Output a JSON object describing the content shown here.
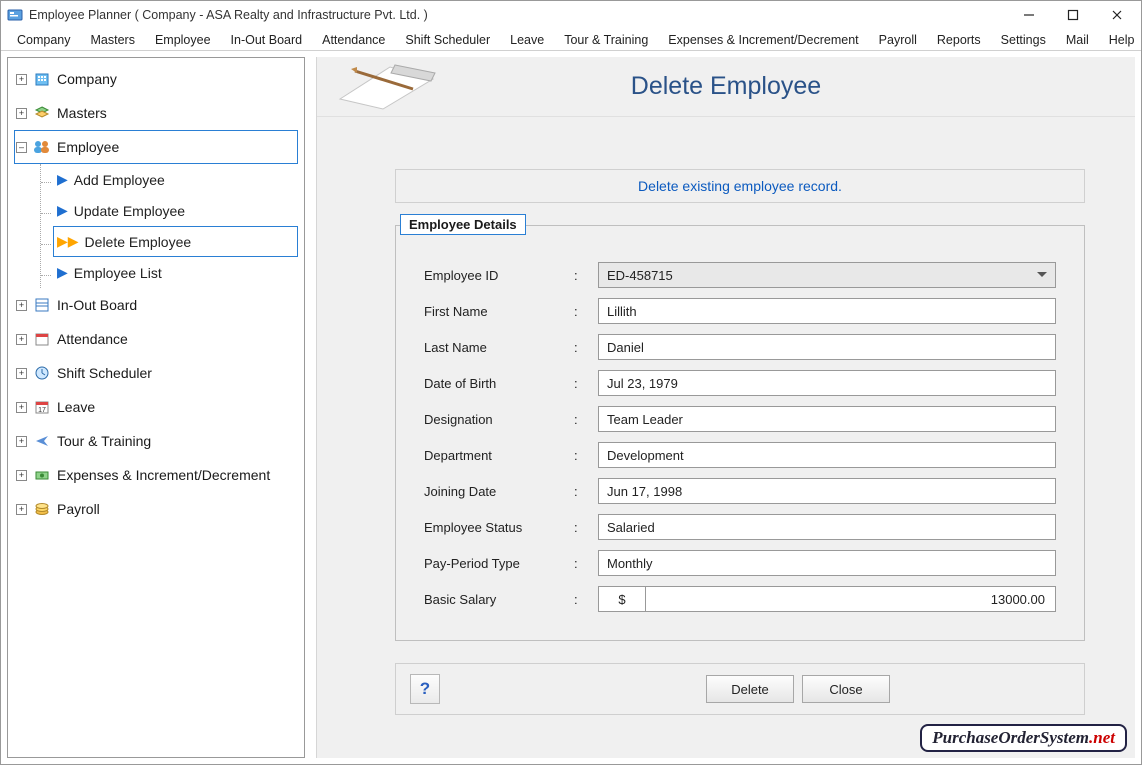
{
  "window": {
    "title": "Employee Planner ( Company - ASA Realty and Infrastructure Pvt. Ltd. )"
  },
  "menubar": [
    "Company",
    "Masters",
    "Employee",
    "In-Out Board",
    "Attendance",
    "Shift Scheduler",
    "Leave",
    "Tour & Training",
    "Expenses & Increment/Decrement",
    "Payroll",
    "Reports",
    "Settings",
    "Mail",
    "Help"
  ],
  "sidebar": {
    "items": [
      {
        "label": "Company"
      },
      {
        "label": "Masters"
      },
      {
        "label": "Employee"
      },
      {
        "label": "In-Out Board"
      },
      {
        "label": "Attendance"
      },
      {
        "label": "Shift Scheduler"
      },
      {
        "label": "Leave"
      },
      {
        "label": "Tour & Training"
      },
      {
        "label": "Expenses & Increment/Decrement"
      },
      {
        "label": "Payroll"
      }
    ],
    "employee_children": [
      {
        "label": "Add Employee"
      },
      {
        "label": "Update Employee"
      },
      {
        "label": "Delete Employee"
      },
      {
        "label": "Employee List"
      }
    ],
    "selected_parent_index": 2,
    "selected_child_index": 2
  },
  "main": {
    "heading": "Delete Employee",
    "banner": "Delete existing employee record.",
    "group_title": "Employee Details",
    "fields": {
      "employee_id": {
        "label": "Employee ID",
        "value": "ED-458715"
      },
      "first_name": {
        "label": "First Name",
        "value": "Lillith"
      },
      "last_name": {
        "label": "Last Name",
        "value": "Daniel"
      },
      "dob": {
        "label": "Date of Birth",
        "value": "Jul 23, 1979"
      },
      "designation": {
        "label": "Designation",
        "value": "Team Leader"
      },
      "department": {
        "label": "Department",
        "value": "Development"
      },
      "joining_date": {
        "label": "Joining Date",
        "value": "Jun 17, 1998"
      },
      "status": {
        "label": "Employee Status",
        "value": "Salaried"
      },
      "pay_period": {
        "label": "Pay-Period Type",
        "value": "Monthly"
      },
      "basic_salary": {
        "label": "Basic Salary",
        "currency": "$",
        "value": "13000.00"
      }
    },
    "buttons": {
      "help": "?",
      "delete": "Delete",
      "close": "Close"
    }
  },
  "watermark": {
    "a": "PurchaseOrderSystem",
    "b": ".net"
  },
  "colons": ":"
}
